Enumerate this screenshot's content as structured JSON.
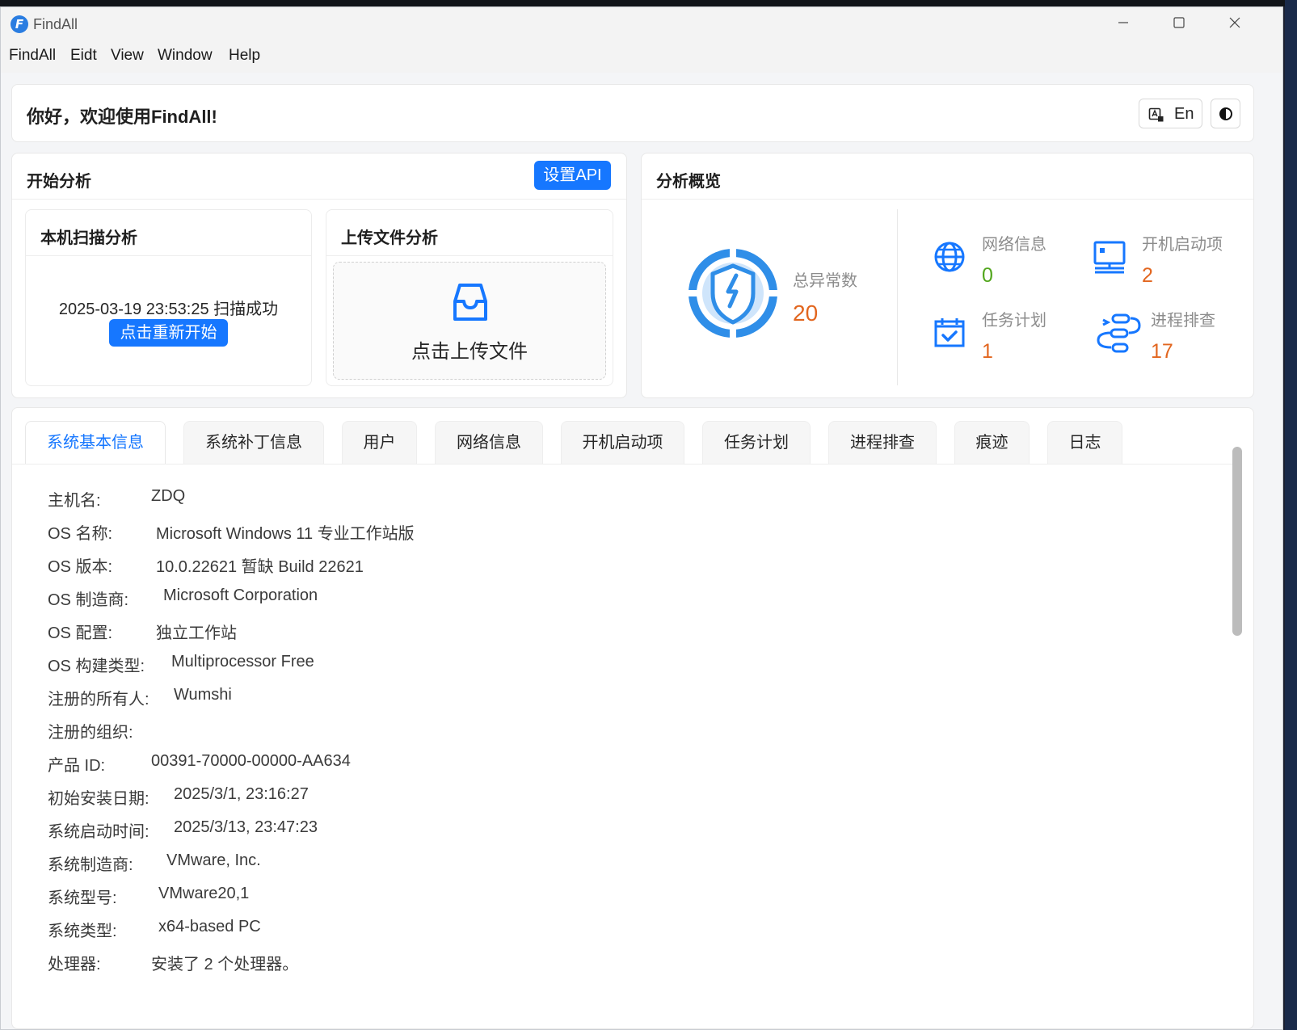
{
  "window": {
    "title": "FindAll",
    "logo_letter": "F"
  },
  "menu": [
    "FindAll",
    "Eidt",
    "View",
    "Window",
    "Help"
  ],
  "greeting": {
    "text": "你好，欢迎使用FindAll!",
    "lang_button": "En"
  },
  "start_panel": {
    "title": "开始分析",
    "api_button": "设置API",
    "local_scan": {
      "title": "本机扫描分析",
      "status": "2025-03-19 23:53:25 扫描成功",
      "restart_button": "点击重新开始"
    },
    "upload": {
      "title": "上传文件分析",
      "label": "点击上传文件"
    }
  },
  "overview": {
    "title": "分析概览",
    "total": {
      "label": "总异常数",
      "value": "20"
    },
    "stats": [
      {
        "label": "网络信息",
        "value": "0",
        "icon": "globe-icon",
        "color": "#52a61d"
      },
      {
        "label": "开机启动项",
        "value": "2",
        "icon": "monitor-icon",
        "color": "#e2661f"
      },
      {
        "label": "任务计划",
        "value": "1",
        "icon": "calendar-check-icon",
        "color": "#e2661f"
      },
      {
        "label": "进程排查",
        "value": "17",
        "icon": "process-icon",
        "color": "#e2661f"
      }
    ]
  },
  "tabs": [
    "系统基本信息",
    "系统补丁信息",
    "用户",
    "网络信息",
    "开机启动项",
    "任务计划",
    "进程排查",
    "痕迹",
    "日志"
  ],
  "active_tab": 0,
  "system_info": [
    {
      "label": "主机名:",
      "value": "ZDQ"
    },
    {
      "label": "OS 名称:",
      "value": "Microsoft Windows 11 专业工作站版"
    },
    {
      "label": "OS 版本:",
      "value": "10.0.22621 暂缺 Build 22621"
    },
    {
      "label": "OS 制造商:",
      "value": "Microsoft Corporation"
    },
    {
      "label": "OS 配置:",
      "value": "独立工作站"
    },
    {
      "label": "OS 构建类型:",
      "value": "Multiprocessor Free"
    },
    {
      "label": "注册的所有人:",
      "value": "Wumshi"
    },
    {
      "label": "注册的组织:",
      "value": ""
    },
    {
      "label": "产品 ID:",
      "value": "00391-70000-00000-AA634"
    },
    {
      "label": "初始安装日期:",
      "value": "2025/3/1, 23:16:27"
    },
    {
      "label": "系统启动时间:",
      "value": "2025/3/13, 23:47:23"
    },
    {
      "label": "系统制造商:",
      "value": "VMware, Inc."
    },
    {
      "label": "系统型号:",
      "value": "VMware20,1"
    },
    {
      "label": "系统类型:",
      "value": "x64-based PC"
    },
    {
      "label": "处理器:",
      "value": "安装了 2 个处理器。"
    }
  ],
  "colors": {
    "primary": "#1677ff",
    "accent": "#e2661f",
    "success": "#52a61d",
    "shield": "#2f8ee8"
  }
}
